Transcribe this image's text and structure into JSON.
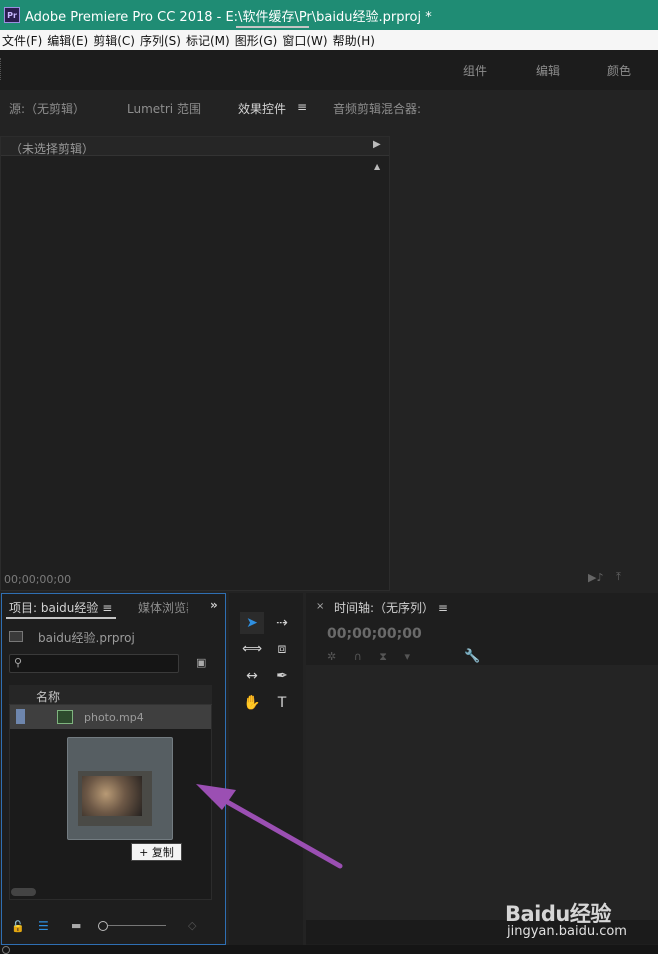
{
  "window": {
    "app_icon": "Pr",
    "title": "Adobe Premiere Pro CC 2018 - E:\\软件缓存\\Pr\\baidu经验.prproj *"
  },
  "menu": [
    "文件(F)",
    "编辑(E)",
    "剪辑(C)",
    "序列(S)",
    "标记(M)",
    "图形(G)",
    "窗口(W)",
    "帮助(H)"
  ],
  "workspaces": [
    "组件",
    "编辑",
    "颜色"
  ],
  "top_panel": {
    "tabs": [
      "源:（无剪辑）",
      "Lumetri 范围",
      "效果控件",
      "音频剪辑混合器:"
    ],
    "active_tab_index": 2,
    "menu_icon": "≡",
    "effect_controls": {
      "no_clip_label": "（未选择剪辑）",
      "timecode": "00;00;00;00"
    }
  },
  "project_panel": {
    "tab_label": "项目: baidu经验",
    "menu_icon": "≡",
    "media_tab_label": "媒体浏览器",
    "overflow_icon": "»",
    "project_file": "baidu经验.prproj",
    "search_placeholder": "",
    "column_header": "名称",
    "items": [
      {
        "name": "photo.mp4",
        "label_color": "#6e86ad"
      }
    ],
    "drag_tooltip": "+ 复制"
  },
  "tools": {
    "icons": [
      "selection-tool-icon",
      "track-select-forward-icon",
      "ripple-edit-icon",
      "razor-icon",
      "slip-icon",
      "pen-icon",
      "hand-icon",
      "type-icon"
    ]
  },
  "timeline": {
    "title": "时间轴:（无序列）",
    "menu_icon": "≡",
    "close_icon": "×",
    "timecode": "00;00;00;00"
  },
  "watermark": {
    "brand": "Baidu经验",
    "url": "jingyan.baidu.com"
  },
  "colors": {
    "titlebar": "#1f8c74",
    "panel_bg": "#232323",
    "focus_border": "#2f6fb3",
    "selection_blue": "#2f8fe0",
    "annotation_arrow": "#9b4fb3"
  }
}
